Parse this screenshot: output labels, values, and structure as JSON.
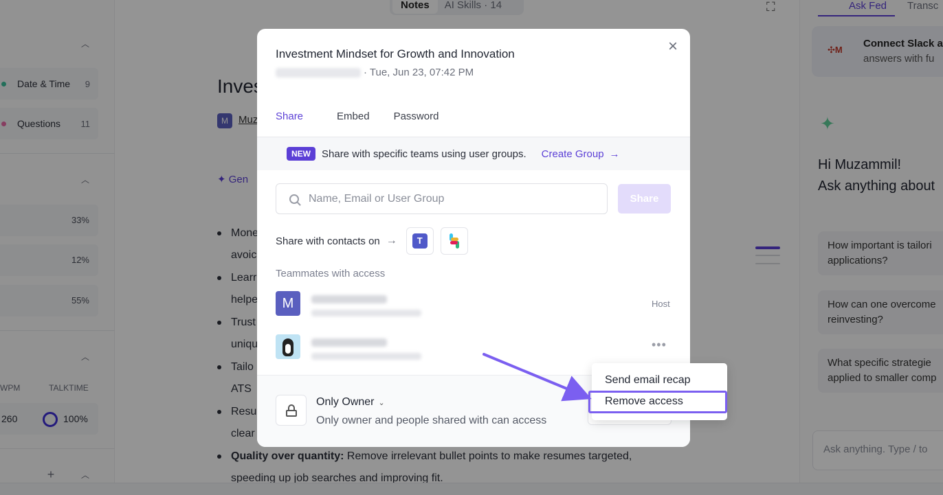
{
  "background": {
    "top_tabs": {
      "notes": "Notes",
      "ai_skills": "AI Skills · 14"
    },
    "left_panel": {
      "date_time": {
        "label": "Date & Time",
        "count": "9",
        "color": "#3bbf9b"
      },
      "questions": {
        "label": "Questions",
        "count": "11",
        "color": "#e86aa8"
      },
      "percentages": [
        "33%",
        "12%",
        "55%"
      ],
      "col_wpm": "WPM",
      "col_talktime": "TALKTIME",
      "wpm_value": "260",
      "talktime_value": "100%"
    },
    "doc": {
      "title": "Inves",
      "owner_initial": "M",
      "owner_name": "Muz",
      "gen_label": "Gen",
      "bullets": [
        "Mone",
        "avoic",
        "Learr",
        "helpe",
        "Trust",
        "uniqu",
        "Tailo",
        "ATS",
        "Resu",
        "clear"
      ],
      "last_bullet_bold": "Quality over quantity:",
      "last_bullet_text": " Remove irrelevant bullet points to make resumes targeted,",
      "last_bullet_line2": "speeding up job searches and improving fit."
    },
    "right_panel": {
      "tab_ask": "Ask Fed",
      "tab_transcript": "Transc",
      "slack_title": "Connect Slack a",
      "slack_sub": "answers with fu",
      "greeting_line1": "Hi Muzammil!",
      "greeting_line2": "Ask anything about",
      "questions": [
        {
          "l1": "How important is tailori",
          "l2": "applications?"
        },
        {
          "l1": "How can one overcome",
          "l2": "reinvesting?"
        },
        {
          "l1": "What specific strategie",
          "l2": "applied to smaller comp"
        }
      ],
      "ask_placeholder": "Ask anything. Type / to"
    }
  },
  "modal": {
    "title": "Investment Mindset for Growth and Innovation",
    "subtitle": "· Tue, Jun 23, 07:42 PM",
    "tabs": [
      "Share",
      "Embed",
      "Password"
    ],
    "active_tab": "Share",
    "banner": {
      "badge": "NEW",
      "text": "Share with specific teams using user groups.",
      "link": "Create Group"
    },
    "search": {
      "placeholder": "Name, Email or User Group",
      "value": ""
    },
    "share_button": "Share",
    "contacts_label": "Share with contacts on",
    "section_label": "Teammates with access",
    "teammates": [
      {
        "initial": "M",
        "role": "Host"
      },
      {
        "initial": "",
        "role": ""
      }
    ],
    "footer": {
      "access_title": "Only Owner",
      "access_desc": "Only owner and people shared with can access"
    }
  },
  "dropdown": {
    "items": [
      "Send email recap",
      "Remove access"
    ],
    "highlighted": "Remove access",
    "highlight_color": "#7b5ff0"
  },
  "colors": {
    "accent": "#5b3fd6",
    "overlay": "rgba(0,0,0,0.42)",
    "share_btn_disabled": "#e3dcfb"
  }
}
